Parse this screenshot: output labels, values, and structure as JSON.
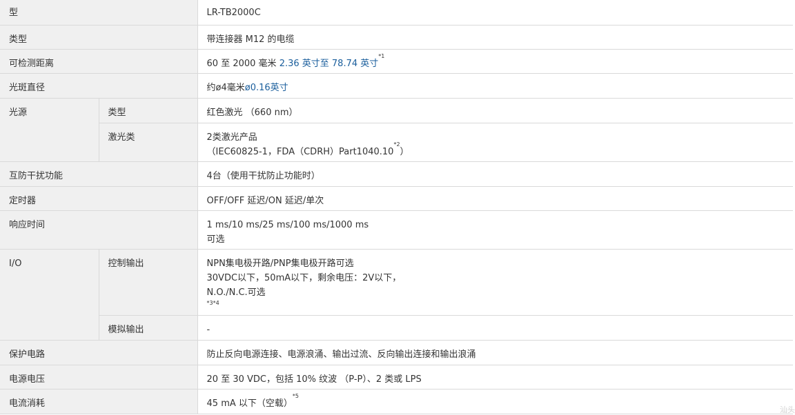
{
  "rows": {
    "model": {
      "label": "型",
      "value": "LR-TB2000C"
    },
    "type": {
      "label": "类型",
      "value": "带连接器 M12 的电缆"
    },
    "distance": {
      "label": "可检测距离",
      "value_metric": "60 至 2000 毫米",
      "value_imperial": "2.36 英寸至 78.74 英寸",
      "note": "*1"
    },
    "spot": {
      "label": "光斑直径",
      "value_metric": "约ø4毫米",
      "value_imperial": "ø0.16英寸"
    },
    "light_source": {
      "label": "光源",
      "type_label": "类型",
      "type_value": "红色激光 （660 nm）",
      "class_label": "激光类",
      "class_line1": "2类激光产品",
      "class_line2": "（IEC60825-1，FDA（CDRH）Part1040.10",
      "class_note": "*2",
      "class_close": "）"
    },
    "interference": {
      "label": "互防干扰功能",
      "value": "4台（使用干扰防止功能时）"
    },
    "timer": {
      "label": "定时器",
      "value": "OFF/OFF 延迟/ON 延迟/单次"
    },
    "response": {
      "label": "响应时间",
      "line1": "1 ms/10 ms/25 ms/100 ms/1000 ms",
      "line2": "可选"
    },
    "io": {
      "label": "I/O",
      "control_label": "控制输出",
      "control_line1": "NPN集电极开路/PNP集电极开路可选",
      "control_line2": "30VDC以下，50mA以下，剩余电压：2V以下，",
      "control_line3": "N.O./N.C.可选",
      "control_note": "*3*4",
      "analog_label": "模拟输出",
      "analog_value": "-"
    },
    "protection": {
      "label": "保护电路",
      "value": "防止反向电源连接、电源浪涌、输出过流、反向输出连接和输出浪涌"
    },
    "voltage": {
      "label": "电源电压",
      "value": "20 至 30 VDC，包括 10% 纹波 （P-P）、2 类或 LPS"
    },
    "current": {
      "label": "电流消耗",
      "value": "45 mA 以下（空载）",
      "note": "*5"
    }
  },
  "watermark": "汕头"
}
